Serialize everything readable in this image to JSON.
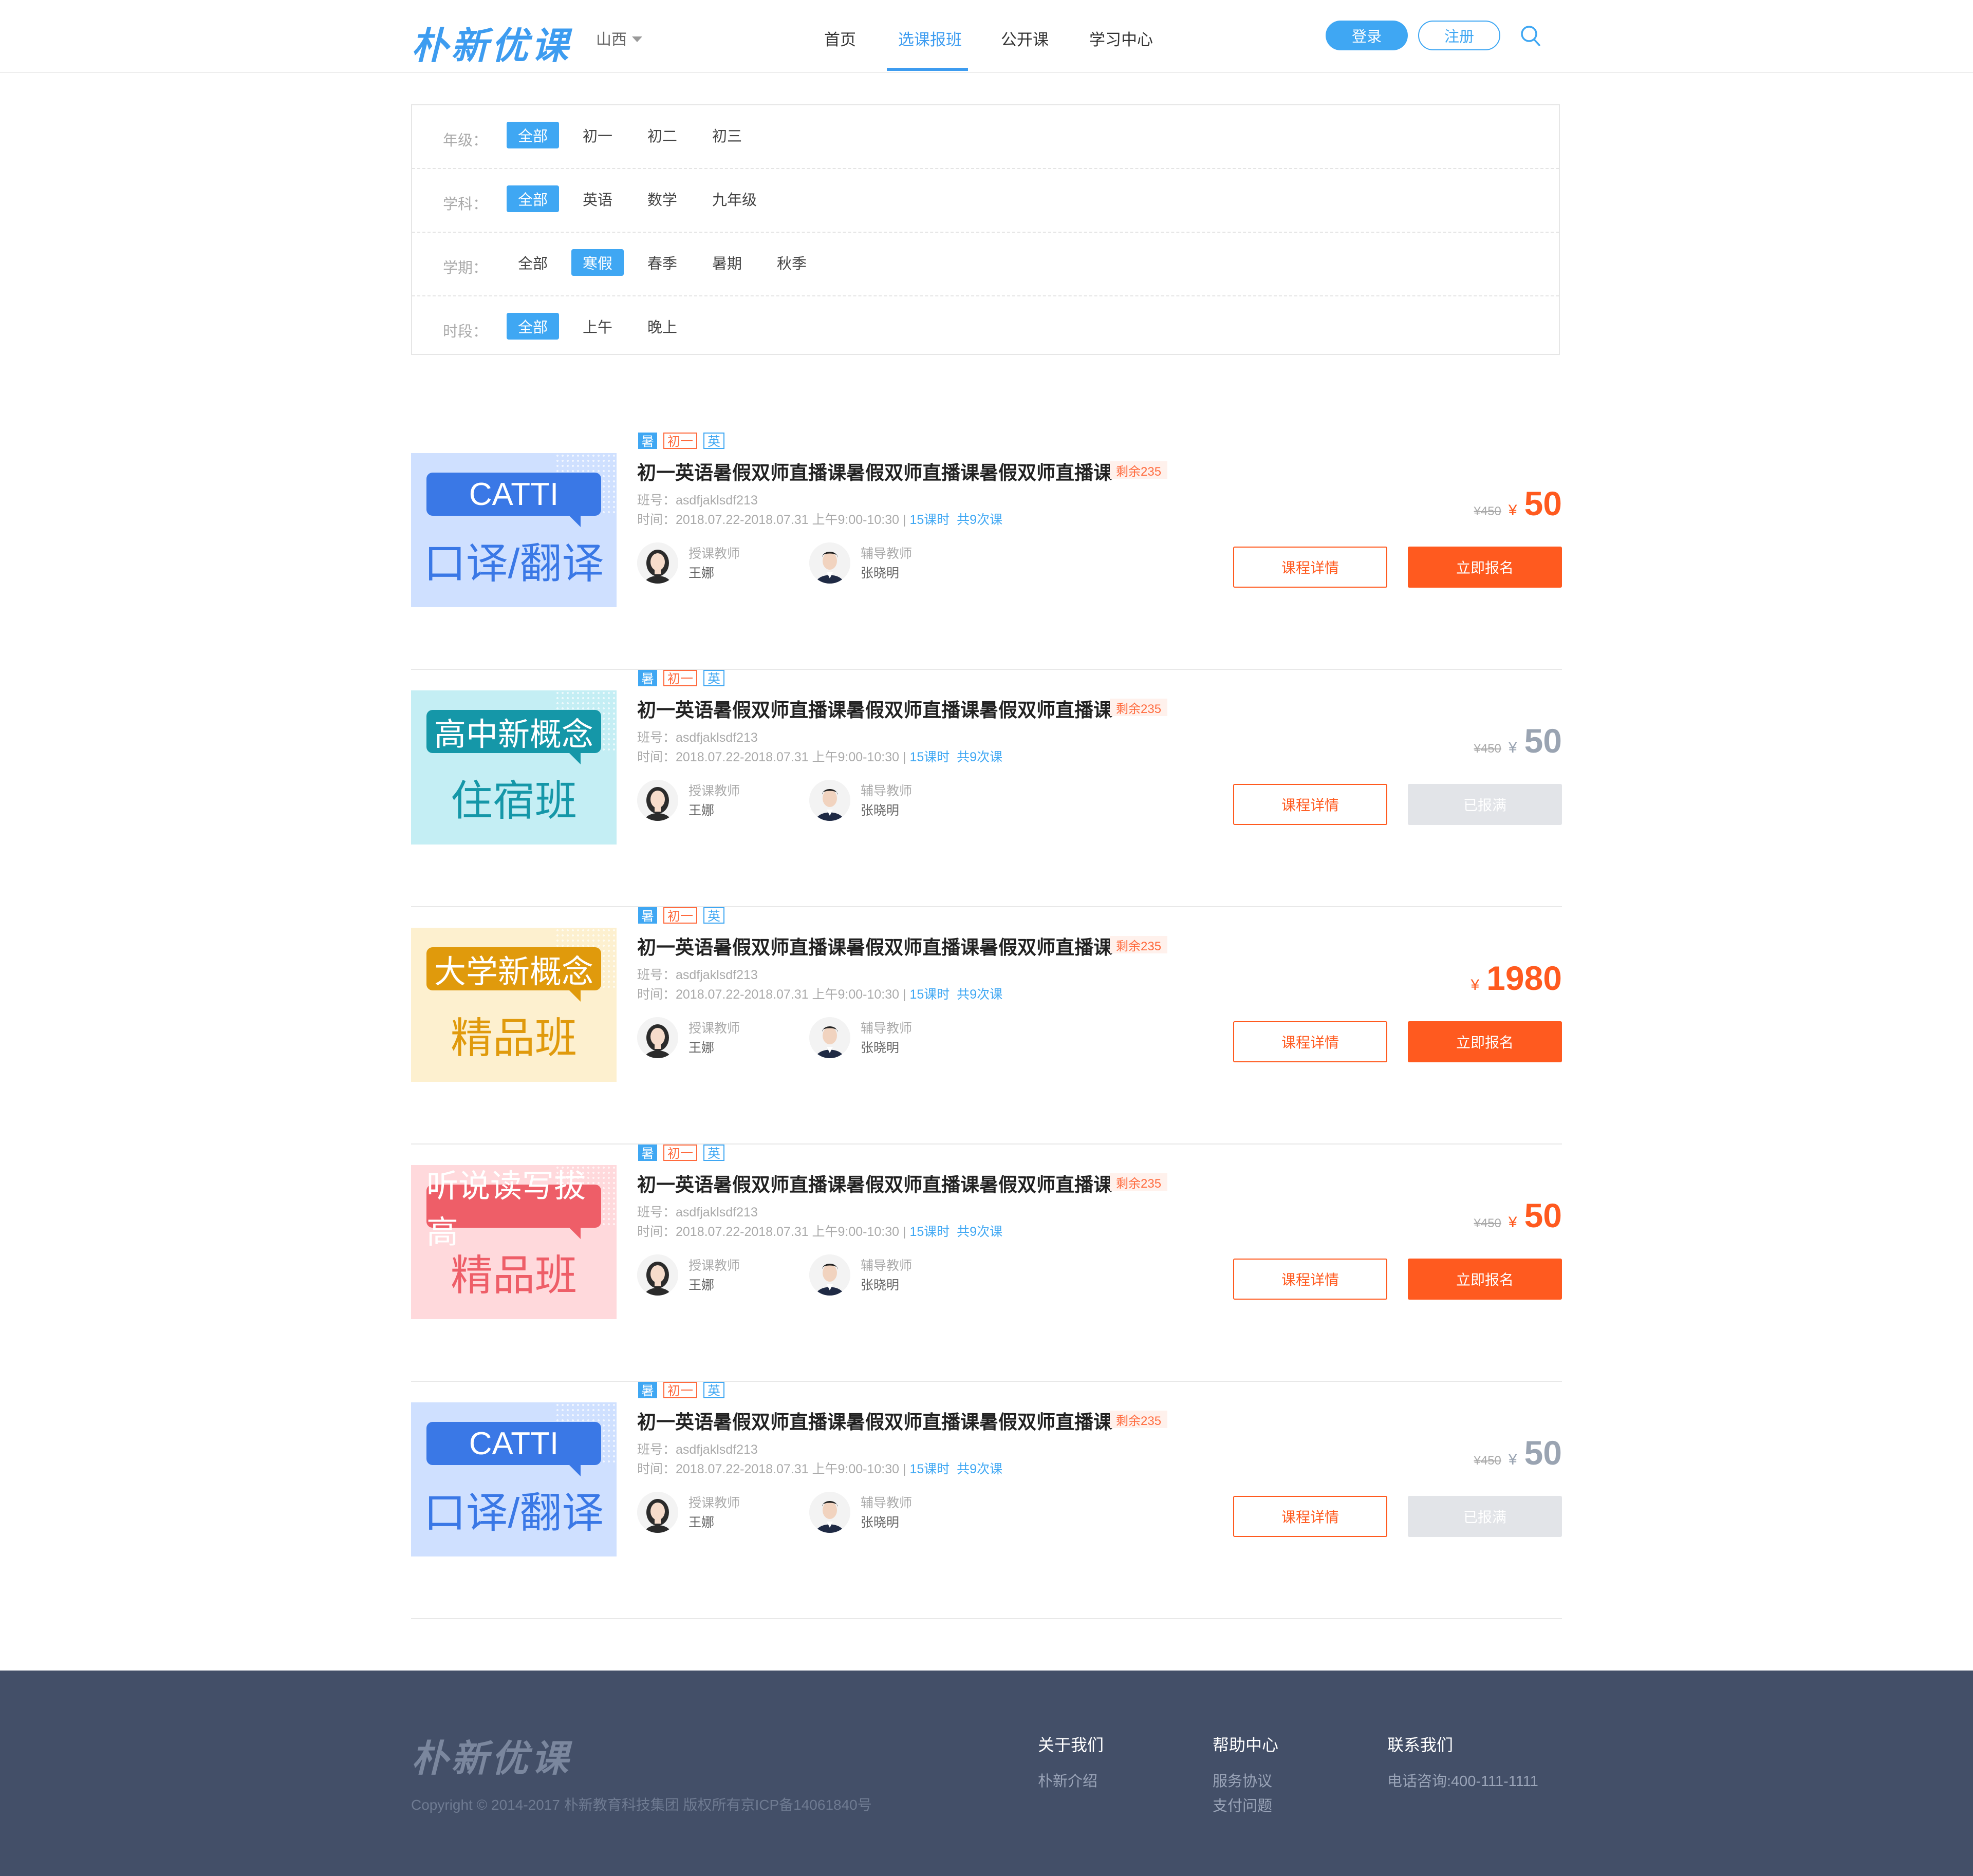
{
  "header": {
    "logo": "朴新优课",
    "region": "山西",
    "nav": [
      "首页",
      "选课报班",
      "公开课",
      "学习中心"
    ],
    "nav_active": 1,
    "login": "登录",
    "register": "注册"
  },
  "filters": {
    "rows": [
      {
        "label": "年级：",
        "options": [
          "全部",
          "初一",
          "初二",
          "初三"
        ],
        "selected": 0
      },
      {
        "label": "学科：",
        "options": [
          "全部",
          "英语",
          "数学",
          "九年级"
        ],
        "selected": 0
      },
      {
        "label": "学期：",
        "options": [
          "全部",
          "寒假",
          "春季",
          "暑期",
          "秋季"
        ],
        "selected": 1
      },
      {
        "label": "时段：",
        "options": [
          "全部",
          "上午",
          "晚上"
        ],
        "selected": 0
      }
    ]
  },
  "courses": [
    {
      "thumb": {
        "main": "CATTI",
        "sub": "口译/翻译",
        "bg": "#cfe0ff",
        "accent": "#3a78e6",
        "subcolor": "#3a78e6"
      },
      "tags": [
        "暑",
        "初一",
        "英"
      ],
      "title": "初一英语暑假双师直播课暑假双师直播课暑假双师直播课",
      "remain": "剩余235",
      "class_no": "班号：asdfjaklsdf213",
      "time": "时间：2018.07.22-2018.07.31 上午9:00-10:30 | ",
      "hours": "15课时",
      "sessions": "共9次课",
      "teacher_role": "授课教师",
      "teacher_name": "王娜",
      "tutor_role": "辅导教师",
      "tutor_name": "张晓明",
      "old_price": "¥450",
      "currency": "¥",
      "price": "50",
      "available": true,
      "detail_label": "课程详情",
      "enroll_label": "立即报名"
    },
    {
      "thumb": {
        "main": "高中新概念",
        "sub": "住宿班",
        "bg": "#c4eef4",
        "accent": "#1597a8",
        "subcolor": "#1597a8"
      },
      "tags": [
        "暑",
        "初一",
        "英"
      ],
      "title": "初一英语暑假双师直播课暑假双师直播课暑假双师直播课",
      "remain": "剩余235",
      "class_no": "班号：asdfjaklsdf213",
      "time": "时间：2018.07.22-2018.07.31 上午9:00-10:30 | ",
      "hours": "15课时",
      "sessions": "共9次课",
      "teacher_role": "授课教师",
      "teacher_name": "王娜",
      "tutor_role": "辅导教师",
      "tutor_name": "张晓明",
      "old_price": "¥450",
      "currency": "¥",
      "price": "50",
      "available": false,
      "detail_label": "课程详情",
      "enroll_label": "已报满"
    },
    {
      "thumb": {
        "main": "大学新概念",
        "sub": "精品班",
        "bg": "#fdf0cf",
        "accent": "#e09a0c",
        "subcolor": "#e09a0c"
      },
      "tags": [
        "暑",
        "初一",
        "英"
      ],
      "title": "初一英语暑假双师直播课暑假双师直播课暑假双师直播课",
      "remain": "剩余235",
      "class_no": "班号：asdfjaklsdf213",
      "time": "时间：2018.07.22-2018.07.31 上午9:00-10:30 | ",
      "hours": "15课时",
      "sessions": "共9次课",
      "teacher_role": "授课教师",
      "teacher_name": "王娜",
      "tutor_role": "辅导教师",
      "tutor_name": "张晓明",
      "old_price": "",
      "currency": "¥",
      "price": "1980",
      "available": true,
      "detail_label": "课程详情",
      "enroll_label": "立即报名"
    },
    {
      "thumb": {
        "main": "听说读写拔高",
        "sub": "精品班",
        "bg": "#ffd9dc",
        "accent": "#ee5e68",
        "subcolor": "#ee5e68"
      },
      "tags": [
        "暑",
        "初一",
        "英"
      ],
      "title": "初一英语暑假双师直播课暑假双师直播课暑假双师直播课",
      "remain": "剩余235",
      "class_no": "班号：asdfjaklsdf213",
      "time": "时间：2018.07.22-2018.07.31 上午9:00-10:30 | ",
      "hours": "15课时",
      "sessions": "共9次课",
      "teacher_role": "授课教师",
      "teacher_name": "王娜",
      "tutor_role": "辅导教师",
      "tutor_name": "张晓明",
      "old_price": "¥450",
      "currency": "¥",
      "price": "50",
      "available": true,
      "detail_label": "课程详情",
      "enroll_label": "立即报名"
    },
    {
      "thumb": {
        "main": "CATTI",
        "sub": "口译/翻译",
        "bg": "#cfe0ff",
        "accent": "#3a78e6",
        "subcolor": "#3a78e6"
      },
      "tags": [
        "暑",
        "初一",
        "英"
      ],
      "title": "初一英语暑假双师直播课暑假双师直播课暑假双师直播课",
      "remain": "剩余235",
      "class_no": "班号：asdfjaklsdf213",
      "time": "时间：2018.07.22-2018.07.31 上午9:00-10:30 | ",
      "hours": "15课时",
      "sessions": "共9次课",
      "teacher_role": "授课教师",
      "teacher_name": "王娜",
      "tutor_role": "辅导教师",
      "tutor_name": "张晓明",
      "old_price": "¥450",
      "currency": "¥",
      "price": "50",
      "available": false,
      "detail_label": "课程详情",
      "enroll_label": "已报满"
    }
  ],
  "footer": {
    "logo": "朴新优课",
    "copyright": "Copyright © 2014-2017 朴新教育科技集团 版权所有京ICP备14061840号",
    "columns": [
      {
        "title": "关于我们",
        "items": [
          "朴新介绍"
        ]
      },
      {
        "title": "帮助中心",
        "items": [
          "服务协议",
          "支付问题"
        ]
      },
      {
        "title": "联系我们",
        "items": [
          "电话咨询:400-111-1111"
        ]
      }
    ]
  }
}
